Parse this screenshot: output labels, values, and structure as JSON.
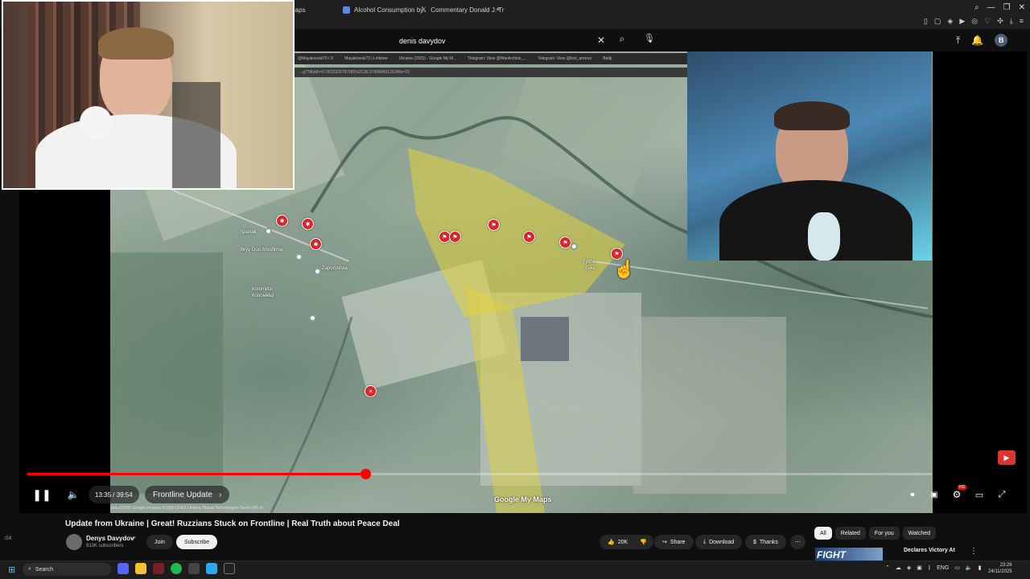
{
  "browser": {
    "tabs": [
      {
        "label": "Maps",
        "color": "#4285f4"
      },
      {
        "label": "Alcohol Consumption by",
        "color": "#5b8ad8"
      },
      {
        "label": "Commentary Donald J. Tr",
        "color": "#ffffff"
      }
    ],
    "new_tab": "+"
  },
  "youtube": {
    "search_query": "denis davydov",
    "avatar_letter": "B"
  },
  "player": {
    "inner_tabs": [
      "@Mayakovski70 / X",
      "Mayakovski73 | Linktree",
      "Ukraine (2025) - Google My M...",
      "Telegram: View @WarArchive_...",
      "Telegram: View @lost_armour",
      "Baltij"
    ],
    "inner_url": "...g778kb8=47.9632325787985%2C36.37908843126348z=15",
    "map_labels": {
      "village_1": "Ibryy Ooo Ahrofirma",
      "village_1b": "Spartak",
      "street_1": "Zaporoshka",
      "village_2": "Kolomiitsi",
      "village_2b": "Коломійці",
      "village_3": "Tykhe",
      "village_3b": "Тихе"
    },
    "progress": 0.374,
    "time": "13:35 / 39:54",
    "chapter": "Frontline Update",
    "attribution": "data ©2025 Google Imagery ©2025 CNES / Airbus, Maxar Technologies  Terms  500 m",
    "google_mark": "Google My Maps",
    "hd_badge": "HD"
  },
  "video": {
    "title": "Update from Ukraine | Great! Ruzzians Stuck on Frontline | Real Truth about Peace Deal",
    "channel": "Denys Davydov",
    "subscribers": "913K subscribers",
    "join": "Join",
    "subscribe": "Subscribe",
    "likes": "20K",
    "share": "Share",
    "download": "Download",
    "thanks": "Thanks"
  },
  "sidebar": {
    "chips": [
      "All",
      "Related",
      "For you",
      "Watched"
    ],
    "rec_thumb_text": "FIGHT",
    "rec_title": "Declares Victory At"
  },
  "taskbar": {
    "search": "Search",
    "tray_lang": "ENG",
    "time": "23:26",
    "date": "24/11/2025"
  },
  "left_rail": {
    "gx": "GX"
  }
}
